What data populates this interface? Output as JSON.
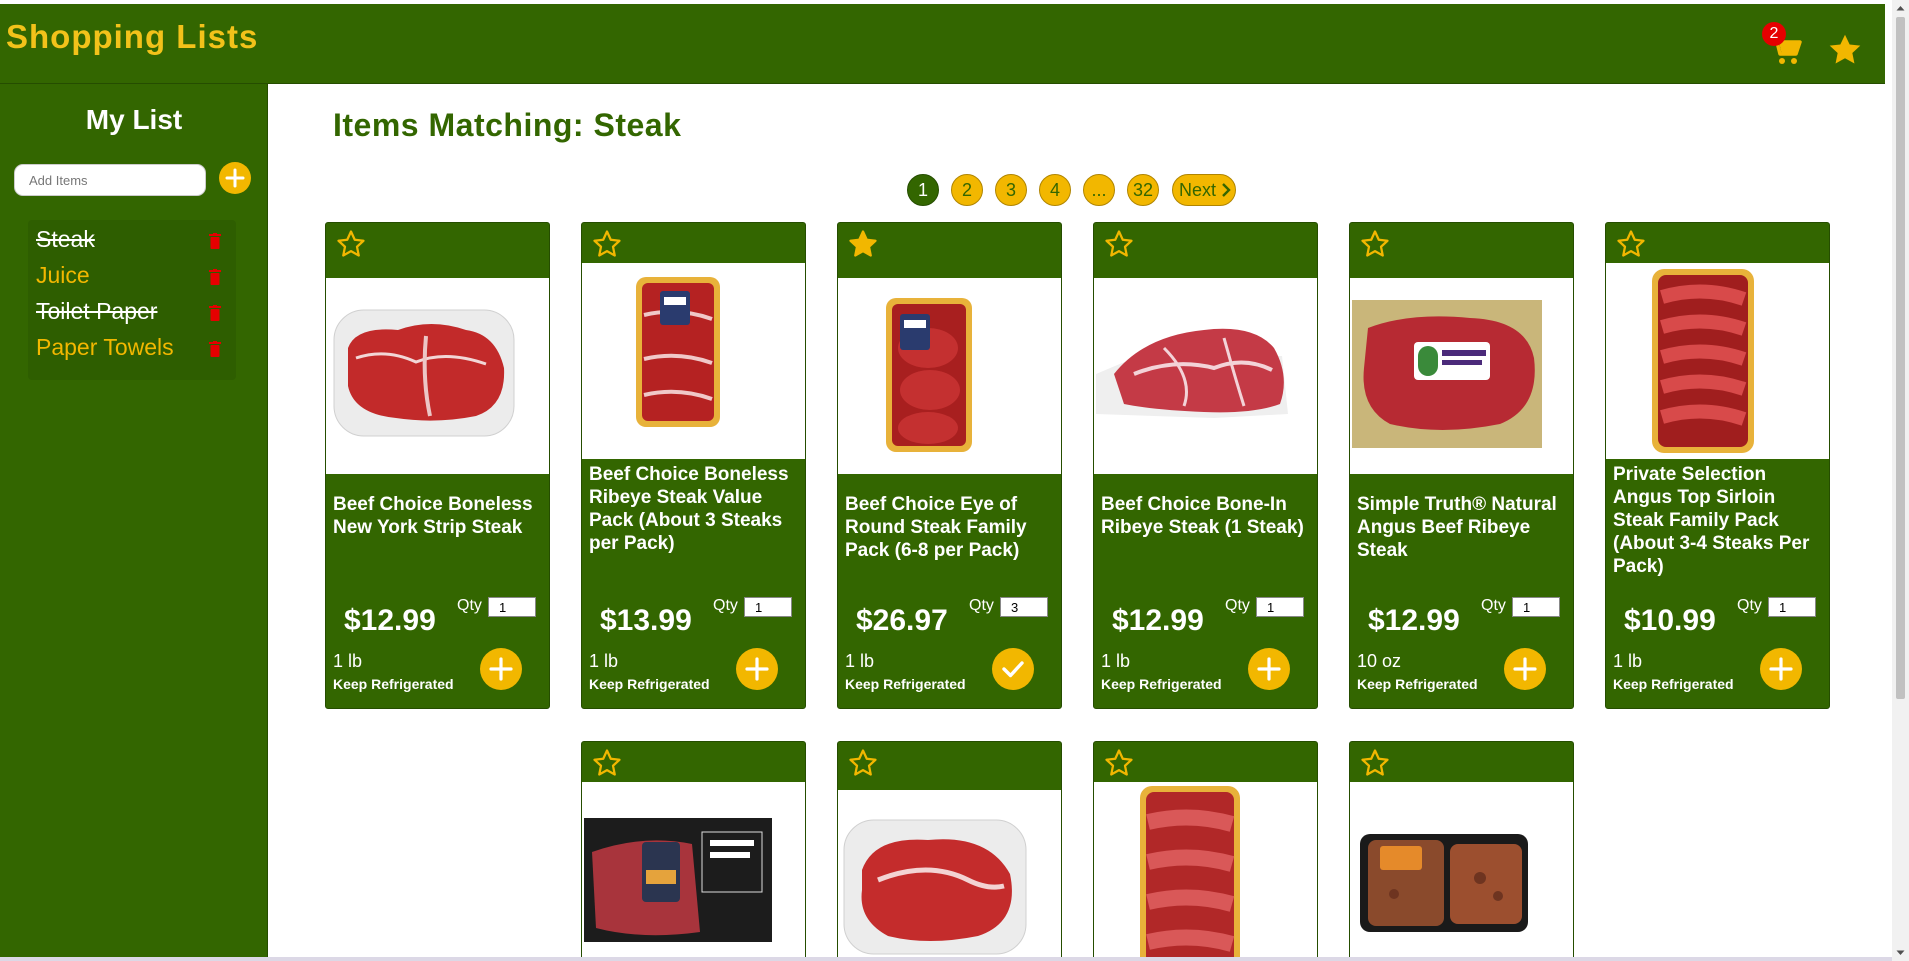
{
  "app": {
    "title": "Shopping Lists",
    "cart_count": "2"
  },
  "colors": {
    "brand_green": "#336600",
    "accent_yellow": "#f2b700",
    "badge_red": "#e60000"
  },
  "sidebar": {
    "title": "My List",
    "add_placeholder": "Add Items",
    "items": [
      {
        "label": "Steak",
        "done": true
      },
      {
        "label": "Juice",
        "done": false
      },
      {
        "label": "Toilet Paper",
        "done": true
      },
      {
        "label": "Paper Towels",
        "done": false
      }
    ]
  },
  "main": {
    "title": "Items Matching: Steak",
    "pagination": {
      "pages": [
        "1",
        "2",
        "3",
        "4",
        "...",
        "32"
      ],
      "current": "1",
      "next_label": "Next"
    }
  },
  "products": [
    {
      "name": "Beef Choice Boneless New York Strip Steak",
      "price": "$12.99",
      "qty_label": "Qty",
      "qty": "1",
      "size": "1 lb",
      "storage": "Keep Refrigerated",
      "favorite": false,
      "in_cart": false,
      "image": "strip-steak-tray"
    },
    {
      "name": "Beef Choice Boneless Ribeye Steak Value Pack (About 3 Steaks per Pack)",
      "price": "$13.99",
      "qty_label": "Qty",
      "qty": "1",
      "size": "1 lb",
      "storage": "Keep Refrigerated",
      "favorite": false,
      "in_cart": false,
      "image": "ribeye-value-pack"
    },
    {
      "name": "Beef Choice Eye of Round Steak Family Pack (6-8 per Pack)",
      "price": "$26.97",
      "qty_label": "Qty",
      "qty": "3",
      "size": "1 lb",
      "storage": "Keep Refrigerated",
      "favorite": true,
      "in_cart": true,
      "image": "eye-of-round-pack"
    },
    {
      "name": "Beef Choice Bone-In Ribeye Steak (1 Steak)",
      "price": "$12.99",
      "qty_label": "Qty",
      "qty": "1",
      "size": "1 lb",
      "storage": "Keep Refrigerated",
      "favorite": false,
      "in_cart": false,
      "image": "bone-in-ribeye"
    },
    {
      "name": "Simple Truth® Natural Angus Beef Ribeye Steak",
      "price": "$12.99",
      "qty_label": "Qty",
      "qty": "1",
      "size": "10 oz",
      "storage": "Keep Refrigerated",
      "favorite": false,
      "in_cart": false,
      "image": "simple-truth-ribeye"
    },
    {
      "name": "Private Selection Angus Top Sirloin Steak Family Pack (About 3-4 Steaks Per Pack)",
      "price": "$10.99",
      "qty_label": "Qty",
      "qty": "1",
      "size": "1 lb",
      "storage": "Keep Refrigerated",
      "favorite": false,
      "in_cart": false,
      "image": "top-sirloin-family-pack"
    },
    {
      "favorite": false,
      "image": "prime-top-sirloin"
    },
    {
      "favorite": false,
      "image": "ribeye-tray"
    },
    {
      "favorite": false,
      "image": "steak-stack-pack"
    },
    {
      "favorite": false,
      "image": "seasoned-steak-pack"
    }
  ]
}
